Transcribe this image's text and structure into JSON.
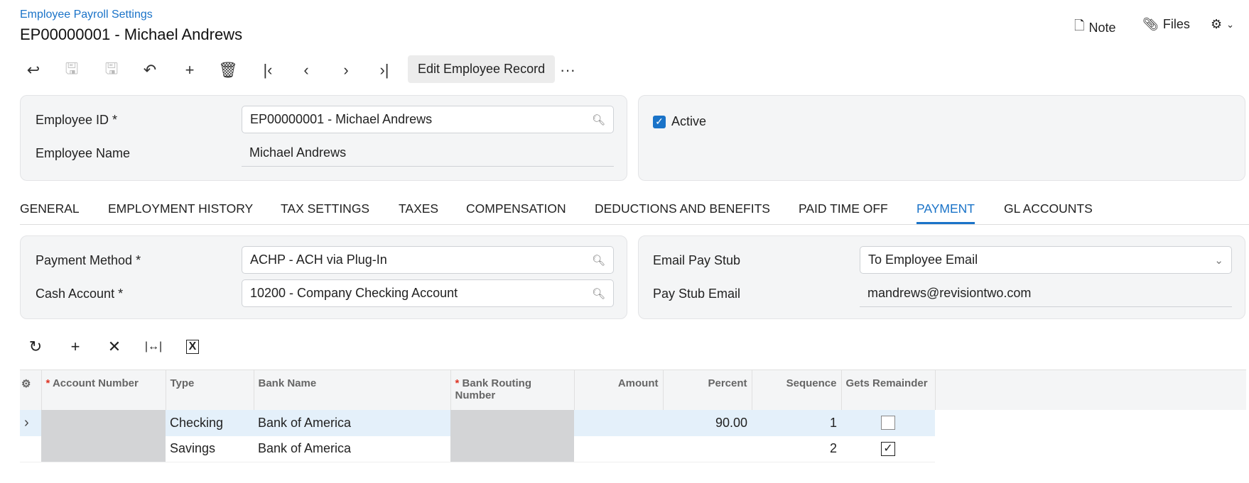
{
  "breadcrumb": "Employee Payroll Settings",
  "title": "EP00000001 - Michael Andrews",
  "header_actions": {
    "note": "Note",
    "files": "Files"
  },
  "toolbar": {
    "edit_label": "Edit Employee Record",
    "more": "···"
  },
  "summary": {
    "employee_id_label": "Employee ID *",
    "employee_id": "EP00000001 - Michael Andrews",
    "employee_name_label": "Employee Name",
    "employee_name": "Michael Andrews",
    "active_label": "Active",
    "active": true
  },
  "tabs": [
    "GENERAL",
    "EMPLOYMENT HISTORY",
    "TAX SETTINGS",
    "TAXES",
    "COMPENSATION",
    "DEDUCTIONS AND BENEFITS",
    "PAID TIME OFF",
    "PAYMENT",
    "GL ACCOUNTS"
  ],
  "active_tab": "PAYMENT",
  "payment": {
    "method_label": "Payment Method *",
    "method": "ACHP - ACH via Plug-In",
    "cash_label": "Cash Account *",
    "cash": "10200 - Company Checking Account",
    "email_stub_label": "Email Pay Stub",
    "email_stub": "To Employee Email",
    "stub_email_label": "Pay Stub Email",
    "stub_email": "mandrews@revisiontwo.com"
  },
  "grid": {
    "headers": {
      "account": "Account Number",
      "type": "Type",
      "bank": "Bank Name",
      "routing": "Bank Routing Number",
      "amount": "Amount",
      "percent": "Percent",
      "sequence": "Sequence",
      "remainder": "Gets Remainder"
    },
    "rows": [
      {
        "type": "Checking",
        "bank": "Bank of America",
        "amount": "",
        "percent": "90.00",
        "sequence": "1",
        "remainder": false
      },
      {
        "type": "Savings",
        "bank": "Bank of America",
        "amount": "",
        "percent": "",
        "sequence": "2",
        "remainder": true
      }
    ]
  }
}
